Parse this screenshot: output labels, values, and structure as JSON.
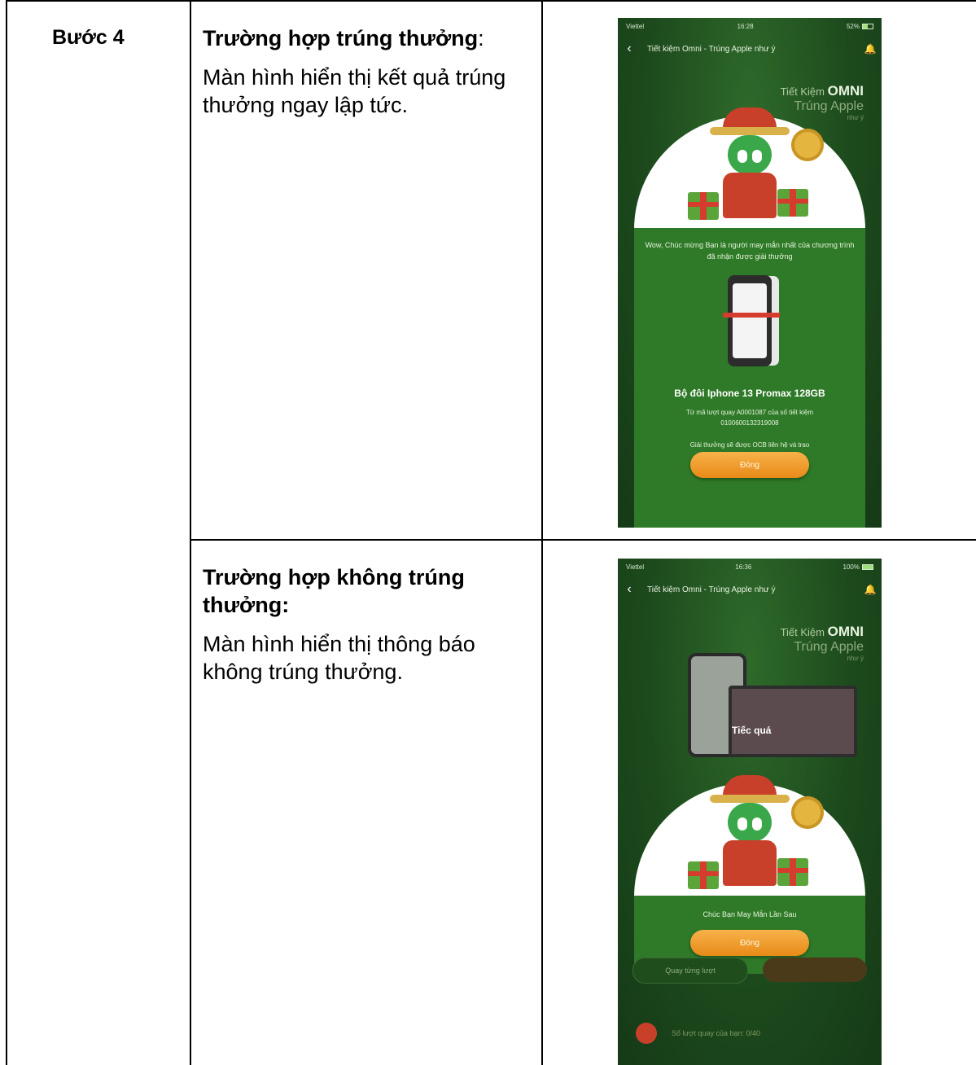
{
  "step": {
    "label": "Bước 4"
  },
  "cases": [
    {
      "title": "Trường hợp trúng thưởng",
      "title_suffix": ":",
      "description": "Màn hình hiển thị kết quả trúng thưởng ngay lập tức."
    },
    {
      "title": "Trường hợp không trúng thưởng:",
      "description": "Màn hình hiển thị thông báo không trúng thưởng."
    }
  ],
  "screen_win": {
    "carrier": "Viettel",
    "time": "16:28",
    "battery": "52%",
    "nav_title": "Tiết kiệm Omni - Trúng Apple như ý",
    "brand": {
      "line1_prefix": "Tiết Kiệm",
      "line1_bold": "OMNI",
      "line2": "Trúng Apple",
      "line3": "như ý"
    },
    "message": "Wow, Chúc mừng Bạn là người may mắn nhất của chương trình đã nhận được giải thưởng",
    "prize_name": "Bộ đôi Iphone 13 Promax 128GB",
    "prize_detail": "Từ mã lượt quay A0001087 của số tiết kiệm 0100600132319008",
    "note": "Giải thưởng sẽ được OCB liên hệ và trao",
    "button": "Đóng"
  },
  "screen_lose": {
    "carrier": "Viettel",
    "time": "16:36",
    "battery": "100%",
    "nav_title": "Tiết kiệm Omni - Trúng Apple như ý",
    "brand": {
      "line1_prefix": "Tiết Kiệm",
      "line1_bold": "OMNI",
      "line2": "Trúng Apple",
      "line3": "như ý"
    },
    "banner": "Tiếc quá",
    "message": "Chúc Bạn May Mắn Lần Sau",
    "button": "Đóng",
    "spin_button": "Quay từng lượt",
    "spins_left": "Số lượt quay của bạn: 0/40"
  }
}
